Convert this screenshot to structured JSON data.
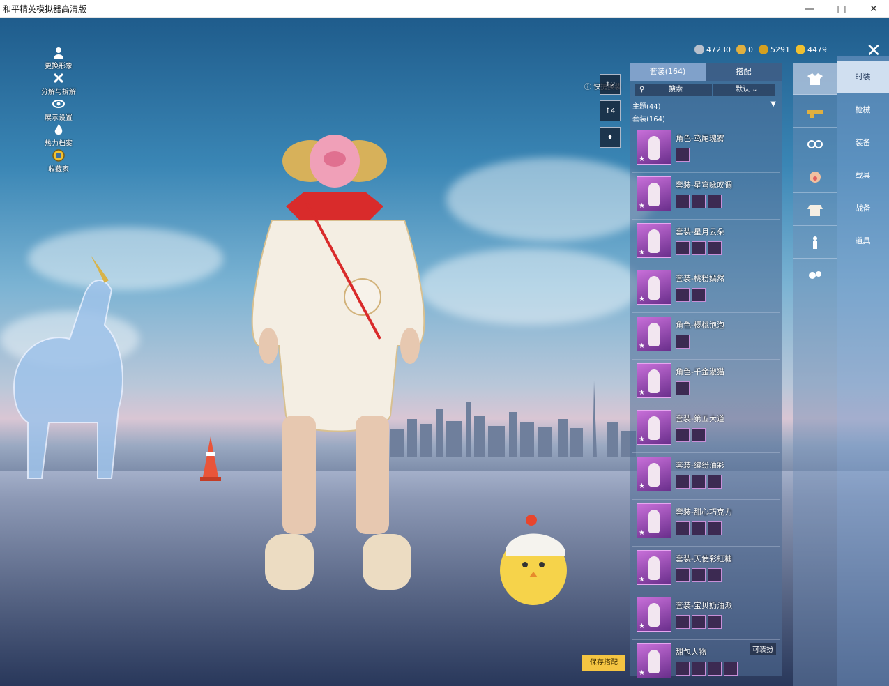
{
  "window": {
    "title": "和平精英模拟器高清版"
  },
  "left_menu": [
    {
      "label": "更换形象",
      "icon": "person-icon"
    },
    {
      "label": "分解与拆解",
      "icon": "dismantle-icon"
    },
    {
      "label": "展示设置",
      "icon": "eye-icon"
    },
    {
      "label": "热力档案",
      "icon": "flame-icon"
    },
    {
      "label": "收藏家",
      "icon": "collector-badge-icon"
    }
  ],
  "currency": [
    {
      "value": "47230",
      "color": "#b8c0cc"
    },
    {
      "value": "0",
      "color": "#e0b040"
    },
    {
      "value": "5291",
      "color": "#d4a020"
    },
    {
      "value": "4479",
      "color": "#f0c030"
    }
  ],
  "quick_change": {
    "label": "快捷换装",
    "slots": [
      "2",
      "4",
      ""
    ]
  },
  "tabs": [
    {
      "label": "套装(164)",
      "active": true
    },
    {
      "label": "搭配",
      "active": false
    }
  ],
  "search": {
    "placeholder": "搜索",
    "sort": "默认"
  },
  "theme": {
    "label": "主题(44)"
  },
  "suit_count": "套装(164)",
  "outfits": [
    {
      "name": "角色-鸢尾瑰雾",
      "subs": 1
    },
    {
      "name": "套装-星穹咏叹调",
      "subs": 3
    },
    {
      "name": "套装-星月云朵",
      "subs": 3
    },
    {
      "name": "套装-桃粉嫣然",
      "subs": 2
    },
    {
      "name": "角色-樱桃泡泡",
      "subs": 1
    },
    {
      "name": "角色-千金淑猫",
      "subs": 1
    },
    {
      "name": "套装-第五大道",
      "subs": 2
    },
    {
      "name": "套装-缤纷油彩",
      "subs": 3
    },
    {
      "name": "套装-甜心巧克力",
      "subs": 3
    },
    {
      "name": "套装-天使彩虹糖",
      "subs": 3
    },
    {
      "name": "套装-宝贝奶油派",
      "subs": 3
    },
    {
      "name": "甜包人物",
      "subs": 4
    }
  ],
  "equip_tag": "可装扮",
  "categories": [
    {
      "label": "时装",
      "active": true
    },
    {
      "label": "枪械",
      "active": false
    },
    {
      "label": "装备",
      "active": false
    },
    {
      "label": "载具",
      "active": false
    },
    {
      "label": "战备",
      "active": false
    },
    {
      "label": "道具",
      "active": false
    }
  ],
  "save_button": "保存搭配"
}
